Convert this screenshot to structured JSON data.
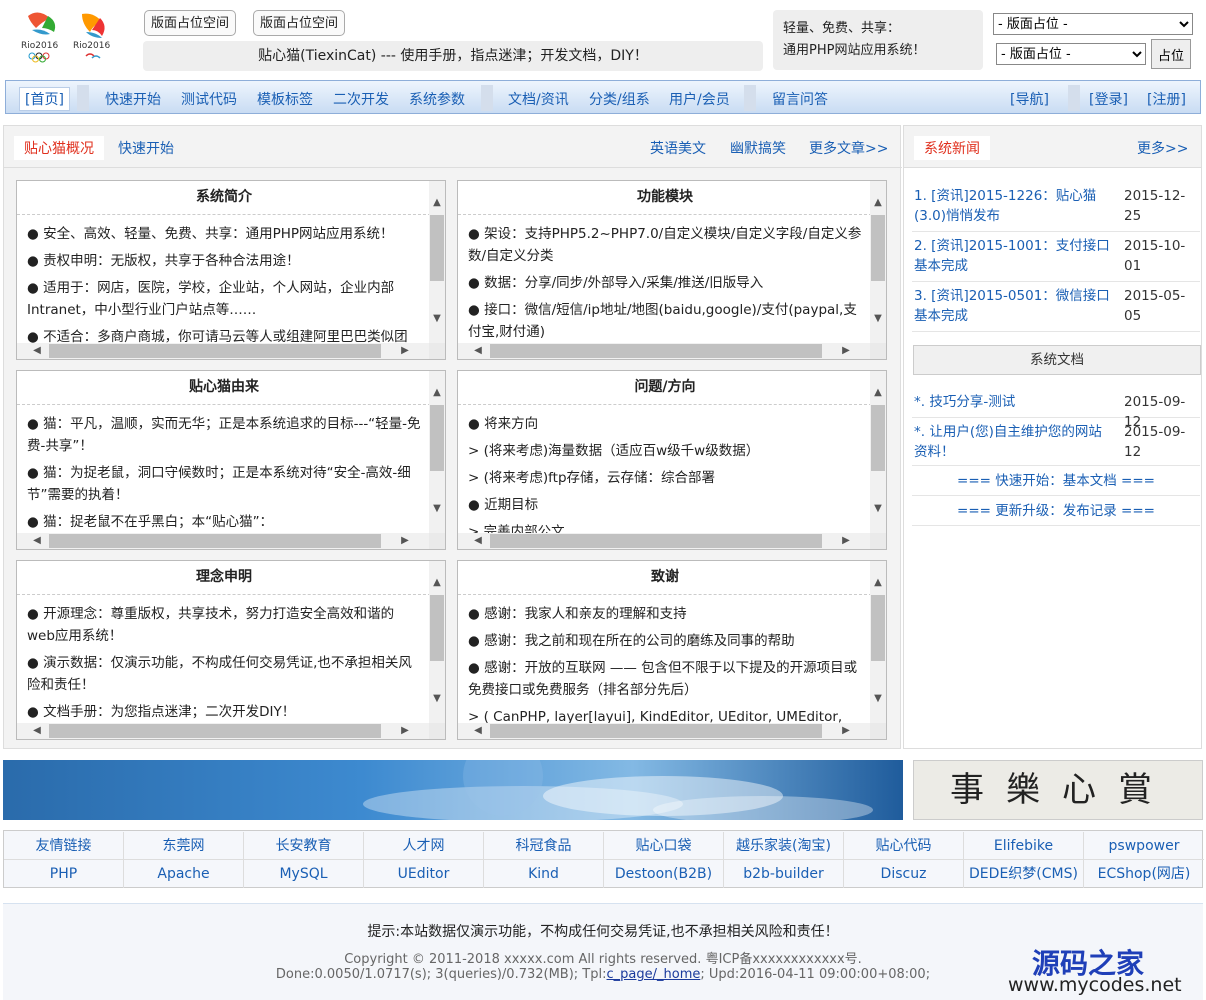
{
  "header": {
    "btn_a": "版面占位空间",
    "btn_b": "版面占位空间",
    "slogan": "贴心猫(TiexinCat) --- 使用手册，指点迷津；开发文档，DIY！",
    "pitch_line1": "轻量、免费、共享：",
    "pitch_line2": "通用PHP网站应用系统！",
    "select1": "- 版面占位 -",
    "select2": "- 版面占位 -",
    "place_button": "占位"
  },
  "nav": {
    "home": "[首页]",
    "items": [
      "快速开始",
      "测试代码",
      "模板标签",
      "二次开发",
      "系统参数",
      "文档/资讯",
      "分类/组系",
      "用户/会员",
      "留言问答"
    ],
    "guide": "[导航]",
    "login": "[登录]",
    "register": "[注册]"
  },
  "main": {
    "tab_active": "贴心猫概况",
    "tab_quick": "快速开始",
    "link_a": "英语美文",
    "link_b": "幽默搞笑",
    "link_more": "更多文章>>",
    "panels": [
      {
        "title": "系统简介",
        "lines": [
          "● 安全、高效、轻量、免费、共享：通用PHP网站应用系统！",
          "● 责权申明：无版权，共享于各种合法用途！",
          "● 适用于：网店，医院，学校，企业站，个人网站，企业内部Intranet，中小型行业门户站点等……",
          "● 不适合：多商户商城，你可请马云等人或组建阿里巴巴类似团"
        ]
      },
      {
        "title": "功能模块",
        "lines": [
          "● 架设：支持PHP5.2~PHP7.0/自定义模块/自定义字段/自定义参数/自定义分类",
          "● 数据：分享/同步/外部导入/采集/推送/旧版导入",
          "● 接口：微信/短信/ip地址/地图(baidu,google)/支付(paypal,支付宝,财付通)"
        ]
      },
      {
        "title": "贴心猫由来",
        "lines": [
          "● 猫：平凡，温顺，实而无华；正是本系统追求的目标---“轻量-免费-共享”！",
          "● 猫：为捉老鼠，洞口守候数时；正是本系统对待“安全-高效-细节”需要的执着！",
          "● 猫：捉老鼠不在乎黑白；本“贴心猫”："
        ]
      },
      {
        "title": "问题/方向",
        "lines": [
          "● 将来方向",
          "> (将来考虑)海量数据（适应百w级千w级数据）",
          "> (将来考虑)ftp存储，云存储：综合部署",
          "● 近期目标",
          "> 完善内部公文"
        ]
      },
      {
        "title": "理念申明",
        "lines": [
          "● 开源理念：尊重版权，共享技术，努力打造安全高效和谐的web应用系统！",
          "● 演示数据：仅演示功能，不构成任何交易凭证,也不承担相关风险和责任！",
          "● 文档手册：为您指点迷津；二次开发DIY！"
        ]
      },
      {
        "title": "致谢",
        "lines": [
          "● 感谢：我家人和亲友的理解和支持",
          "● 感谢：我之前和现在所在的公司的磨练及同事的帮助",
          "● 感谢：开放的互联网 —— 包含但不限于以下提及的开源项目或免费接口或免费服务（排名部分先后）",
          "> ( CanPHP, layer[layui], KindEditor, UEditor, UMEditor,"
        ]
      }
    ]
  },
  "side": {
    "tab": "系统新闻",
    "more": "更多>>",
    "news": [
      {
        "title": "1. [资讯]2015-1226：贴心猫(3.0)悄悄发布",
        "date": "2015-12-25"
      },
      {
        "title": "2. [资讯]2015-1001：支付接口基本完成",
        "date": "2015-10-01"
      },
      {
        "title": "3. [资讯]2015-0501：微信接口基本完成",
        "date": "2015-05-05"
      }
    ],
    "docs_title": "系统文档",
    "docs": [
      {
        "title": "*. 技巧分享-测试",
        "date": "2015-09-12"
      },
      {
        "title": "*. 让用户(您)自主维护您的网站资料！",
        "date": "2015-09-12"
      }
    ],
    "doc_link1": "=== 快速开始：基本文档 ===",
    "doc_link2": "=== 更新升级：发布记录 ==="
  },
  "calligraphy": "事樂心賞",
  "links": {
    "row1": [
      "友情链接",
      "东莞网",
      "长安教育",
      "人才网",
      "科冠食品",
      "贴心口袋",
      "越乐家装(淘宝)",
      "贴心代码",
      "Elifebike",
      "pswpower"
    ],
    "row2": [
      "PHP",
      "Apache",
      "MySQL",
      "UEditor",
      "Kind",
      "Destoon(B2B)",
      "b2b-builder",
      "Discuz",
      "DEDE织梦(CMS)",
      "ECShop(网店)"
    ]
  },
  "footer": {
    "notice": "提示:本站数据仅演示功能，不构成任何交易凭证,也不承担相关风险和责任！",
    "copyright": "Copyright © 2011-2018 xxxxx.com All rights reserved. 粤ICP备xxxxxxxxxxxx号.",
    "stats_prefix": "Done:0.0050/1.0717(s); 3(queries)/0.732(MB); Tpl:",
    "stats_link": "c_page/_home",
    "stats_suffix": "; Upd:2016-04-11 09:00:00+08:00;"
  },
  "watermark": {
    "cn": "源码之家",
    "url": "www.mycodes.net"
  }
}
